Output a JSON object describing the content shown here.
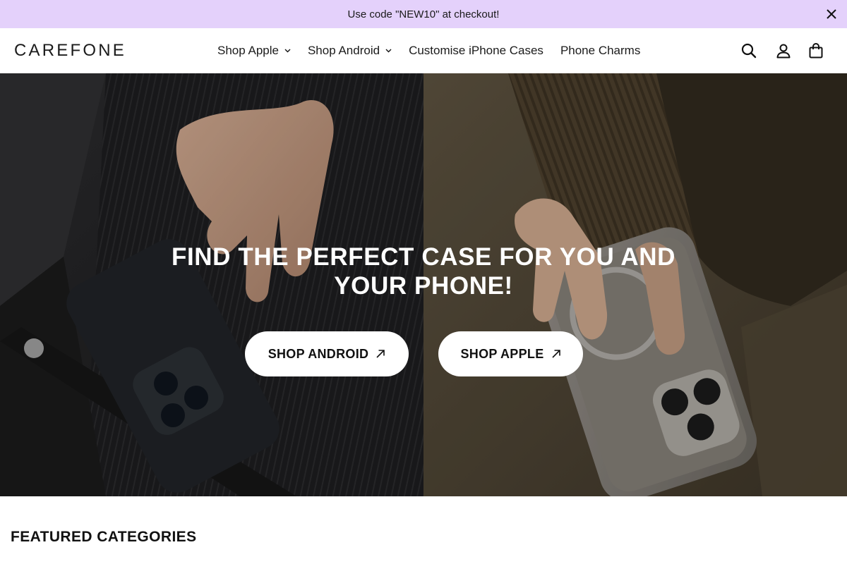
{
  "announcement": {
    "text": "Use code \"NEW10\" at checkout!"
  },
  "header": {
    "logo": "CAREFONE",
    "nav": [
      {
        "label": "Shop Apple",
        "has_dropdown": true
      },
      {
        "label": "Shop Android",
        "has_dropdown": true
      },
      {
        "label": "Customise iPhone Cases",
        "has_dropdown": false
      },
      {
        "label": "Phone Charms",
        "has_dropdown": false
      }
    ],
    "icons": [
      "search-icon",
      "account-icon",
      "cart-icon"
    ]
  },
  "hero": {
    "title": "FIND THE PERFECT CASE FOR YOU AND YOUR PHONE!",
    "buttons": [
      {
        "label": "SHOP ANDROID"
      },
      {
        "label": "SHOP APPLE"
      }
    ]
  },
  "featured": {
    "title": "FEATURED CATEGORIES"
  },
  "colors": {
    "announcement_bg": "#e4d1fb",
    "button_bg": "#ffffff"
  }
}
